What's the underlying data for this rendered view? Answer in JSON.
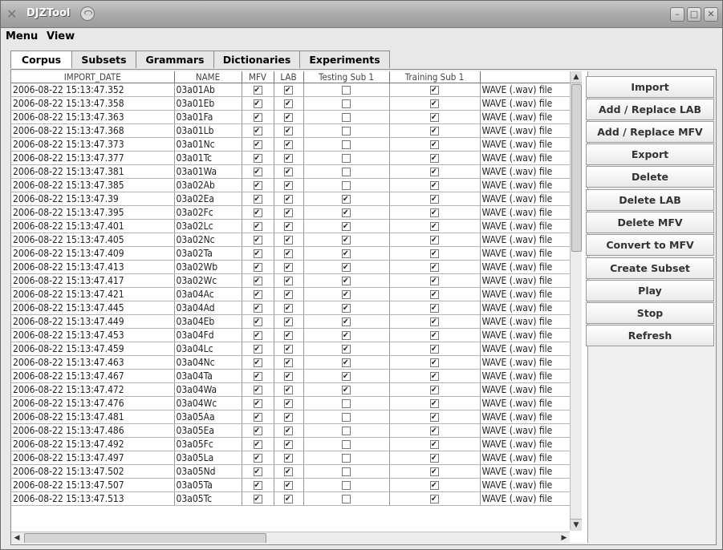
{
  "window": {
    "title": "DJZTool"
  },
  "menu": {
    "items": [
      "Menu",
      "View"
    ]
  },
  "tabs": [
    "Corpus",
    "Subsets",
    "Grammars",
    "Dictionaries",
    "Experiments"
  ],
  "table": {
    "columns": [
      "IMPORT_DATE",
      "NAME",
      "MFV",
      "LAB",
      "Testing Sub 1",
      "Training Sub 1",
      ""
    ],
    "rows": [
      {
        "date": "2006-08-22 15:13:47.352",
        "name": "03a01Ab",
        "mfv": true,
        "lab": true,
        "test": false,
        "train": true,
        "type": "WAVE (.wav) file"
      },
      {
        "date": "2006-08-22 15:13:47.358",
        "name": "03a01Eb",
        "mfv": true,
        "lab": true,
        "test": false,
        "train": true,
        "type": "WAVE (.wav) file"
      },
      {
        "date": "2006-08-22 15:13:47.363",
        "name": "03a01Fa",
        "mfv": true,
        "lab": true,
        "test": false,
        "train": true,
        "type": "WAVE (.wav) file"
      },
      {
        "date": "2006-08-22 15:13:47.368",
        "name": "03a01Lb",
        "mfv": true,
        "lab": true,
        "test": false,
        "train": true,
        "type": "WAVE (.wav) file"
      },
      {
        "date": "2006-08-22 15:13:47.373",
        "name": "03a01Nc",
        "mfv": true,
        "lab": true,
        "test": false,
        "train": true,
        "type": "WAVE (.wav) file"
      },
      {
        "date": "2006-08-22 15:13:47.377",
        "name": "03a01Tc",
        "mfv": true,
        "lab": true,
        "test": false,
        "train": true,
        "type": "WAVE (.wav) file"
      },
      {
        "date": "2006-08-22 15:13:47.381",
        "name": "03a01Wa",
        "mfv": true,
        "lab": true,
        "test": false,
        "train": true,
        "type": "WAVE (.wav) file"
      },
      {
        "date": "2006-08-22 15:13:47.385",
        "name": "03a02Ab",
        "mfv": true,
        "lab": true,
        "test": false,
        "train": true,
        "type": "WAVE (.wav) file"
      },
      {
        "date": "2006-08-22 15:13:47.39",
        "name": "03a02Ea",
        "mfv": true,
        "lab": true,
        "test": true,
        "train": true,
        "type": "WAVE (.wav) file"
      },
      {
        "date": "2006-08-22 15:13:47.395",
        "name": "03a02Fc",
        "mfv": true,
        "lab": true,
        "test": true,
        "train": true,
        "type": "WAVE (.wav) file"
      },
      {
        "date": "2006-08-22 15:13:47.401",
        "name": "03a02Lc",
        "mfv": true,
        "lab": true,
        "test": true,
        "train": true,
        "type": "WAVE (.wav) file"
      },
      {
        "date": "2006-08-22 15:13:47.405",
        "name": "03a02Nc",
        "mfv": true,
        "lab": true,
        "test": true,
        "train": true,
        "type": "WAVE (.wav) file"
      },
      {
        "date": "2006-08-22 15:13:47.409",
        "name": "03a02Ta",
        "mfv": true,
        "lab": true,
        "test": true,
        "train": true,
        "type": "WAVE (.wav) file"
      },
      {
        "date": "2006-08-22 15:13:47.413",
        "name": "03a02Wb",
        "mfv": true,
        "lab": true,
        "test": true,
        "train": true,
        "type": "WAVE (.wav) file"
      },
      {
        "date": "2006-08-22 15:13:47.417",
        "name": "03a02Wc",
        "mfv": true,
        "lab": true,
        "test": true,
        "train": true,
        "type": "WAVE (.wav) file"
      },
      {
        "date": "2006-08-22 15:13:47.421",
        "name": "03a04Ac",
        "mfv": true,
        "lab": true,
        "test": true,
        "train": true,
        "type": "WAVE (.wav) file"
      },
      {
        "date": "2006-08-22 15:13:47.445",
        "name": "03a04Ad",
        "mfv": true,
        "lab": true,
        "test": true,
        "train": true,
        "type": "WAVE (.wav) file"
      },
      {
        "date": "2006-08-22 15:13:47.449",
        "name": "03a04Eb",
        "mfv": true,
        "lab": true,
        "test": true,
        "train": true,
        "type": "WAVE (.wav) file"
      },
      {
        "date": "2006-08-22 15:13:47.453",
        "name": "03a04Fd",
        "mfv": true,
        "lab": true,
        "test": true,
        "train": true,
        "type": "WAVE (.wav) file"
      },
      {
        "date": "2006-08-22 15:13:47.459",
        "name": "03a04Lc",
        "mfv": true,
        "lab": true,
        "test": true,
        "train": true,
        "type": "WAVE (.wav) file"
      },
      {
        "date": "2006-08-22 15:13:47.463",
        "name": "03a04Nc",
        "mfv": true,
        "lab": true,
        "test": true,
        "train": true,
        "type": "WAVE (.wav) file"
      },
      {
        "date": "2006-08-22 15:13:47.467",
        "name": "03a04Ta",
        "mfv": true,
        "lab": true,
        "test": true,
        "train": true,
        "type": "WAVE (.wav) file"
      },
      {
        "date": "2006-08-22 15:13:47.472",
        "name": "03a04Wa",
        "mfv": true,
        "lab": true,
        "test": true,
        "train": true,
        "type": "WAVE (.wav) file"
      },
      {
        "date": "2006-08-22 15:13:47.476",
        "name": "03a04Wc",
        "mfv": true,
        "lab": true,
        "test": false,
        "train": true,
        "type": "WAVE (.wav) file"
      },
      {
        "date": "2006-08-22 15:13:47.481",
        "name": "03a05Aa",
        "mfv": true,
        "lab": true,
        "test": false,
        "train": true,
        "type": "WAVE (.wav) file"
      },
      {
        "date": "2006-08-22 15:13:47.486",
        "name": "03a05Ea",
        "mfv": true,
        "lab": true,
        "test": false,
        "train": true,
        "type": "WAVE (.wav) file"
      },
      {
        "date": "2006-08-22 15:13:47.492",
        "name": "03a05Fc",
        "mfv": true,
        "lab": true,
        "test": false,
        "train": true,
        "type": "WAVE (.wav) file"
      },
      {
        "date": "2006-08-22 15:13:47.497",
        "name": "03a05La",
        "mfv": true,
        "lab": true,
        "test": false,
        "train": true,
        "type": "WAVE (.wav) file"
      },
      {
        "date": "2006-08-22 15:13:47.502",
        "name": "03a05Nd",
        "mfv": true,
        "lab": true,
        "test": false,
        "train": true,
        "type": "WAVE (.wav) file"
      },
      {
        "date": "2006-08-22 15:13:47.507",
        "name": "03a05Ta",
        "mfv": true,
        "lab": true,
        "test": false,
        "train": true,
        "type": "WAVE (.wav) file"
      },
      {
        "date": "2006-08-22 15:13:47.513",
        "name": "03a05Tc",
        "mfv": true,
        "lab": true,
        "test": false,
        "train": true,
        "type": "WAVE (.wav) file"
      }
    ]
  },
  "buttons": [
    "Import",
    "Add / Replace LAB",
    "Add / Replace MFV",
    "Export",
    "Delete",
    "Delete LAB",
    "Delete MFV",
    "Convert to MFV",
    "Create Subset",
    "Play",
    "Stop",
    "Refresh"
  ],
  "icons": {
    "app": "x-logo-icon",
    "title_logo": "swirl-logo-icon",
    "minimize": "minimize-icon",
    "maximize": "maximize-icon",
    "close": "close-icon"
  }
}
